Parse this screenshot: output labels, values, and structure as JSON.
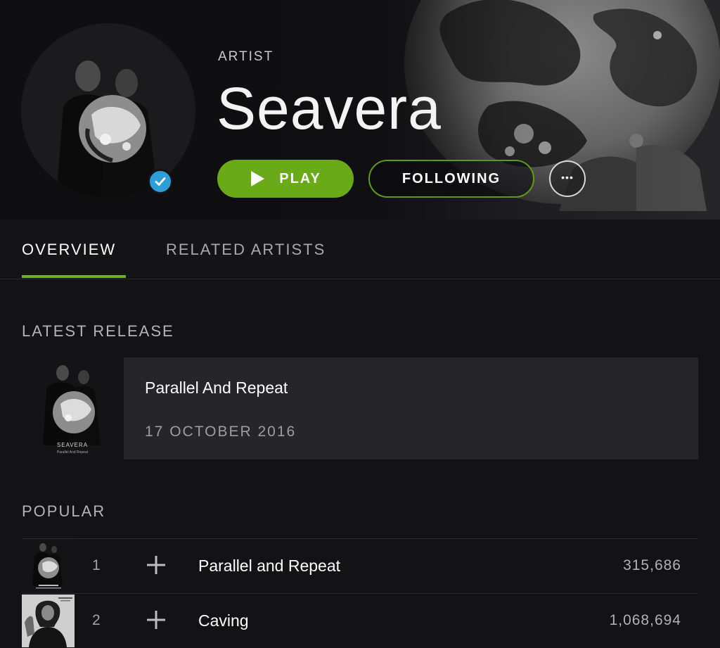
{
  "artist": {
    "type_label": "ARTIST",
    "name": "Seavera",
    "verified": true
  },
  "actions": {
    "play_label": "PLAY",
    "following_label": "FOLLOWING",
    "more_label": "•••"
  },
  "tabs": [
    {
      "label": "OVERVIEW",
      "active": true
    },
    {
      "label": "RELATED ARTISTS",
      "active": false
    }
  ],
  "latest_release": {
    "section_title": "LATEST RELEASE",
    "title": "Parallel And Repeat",
    "date": "17 OCTOBER 2016",
    "cover_text": "SEAVERA",
    "cover_subtext": "Parallel And Repeat"
  },
  "popular": {
    "section_title": "POPULAR",
    "tracks": [
      {
        "number": "1",
        "title": "Parallel and Repeat",
        "plays": "315,686"
      },
      {
        "number": "2",
        "title": "Caving",
        "plays": "1,068,694"
      }
    ]
  },
  "colors": {
    "accent_green": "#6aa918",
    "verified_blue": "#2e9fd6",
    "background": "#131316"
  },
  "icons": {
    "play": "play-triangle-icon",
    "verified": "checkmark-icon",
    "more": "more-dots-icon",
    "add": "plus-icon"
  }
}
